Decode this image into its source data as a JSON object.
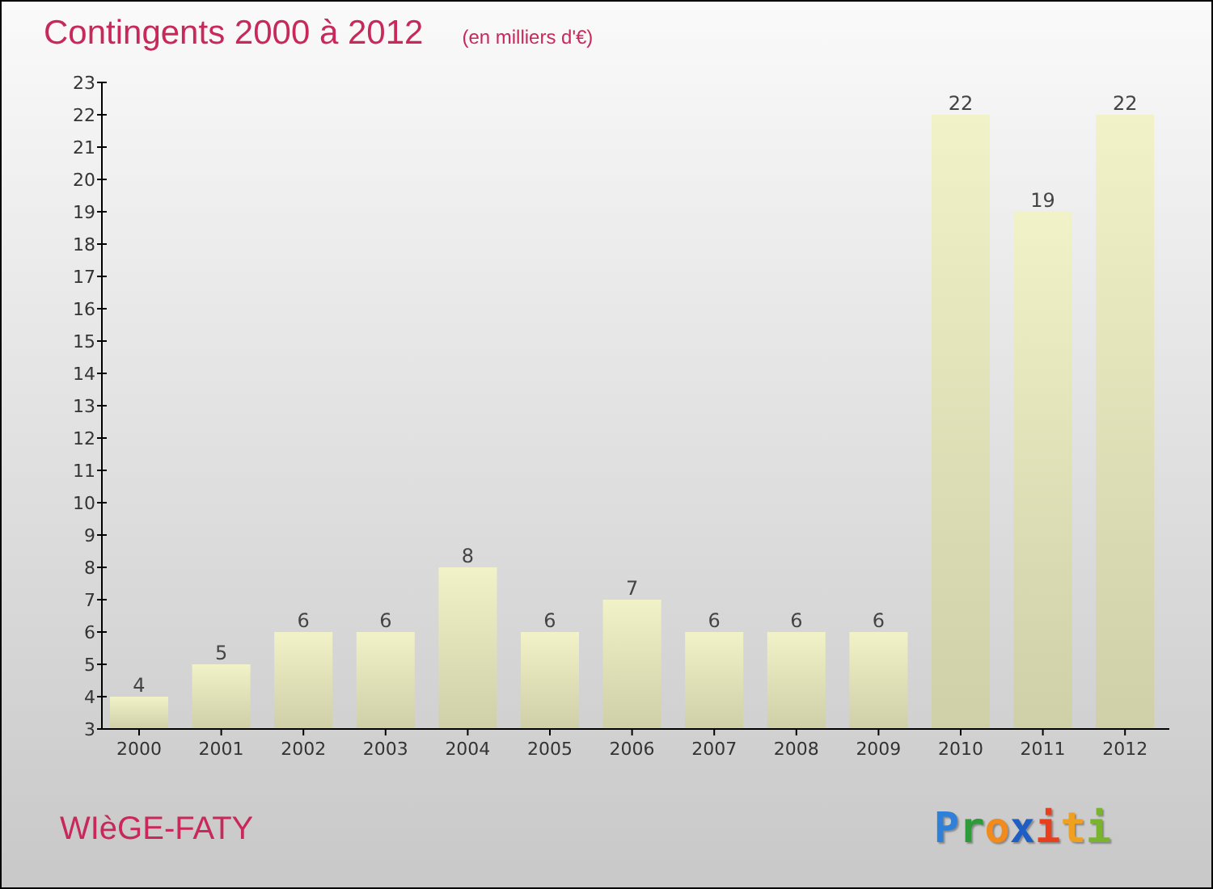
{
  "chart_title": "Contingents 2000 à 2012",
  "unit_note": "(en milliers d'€)",
  "chart_data": {
    "type": "bar",
    "categories": [
      "2000",
      "2001",
      "2002",
      "2003",
      "2004",
      "2005",
      "2006",
      "2007",
      "2008",
      "2009",
      "2010",
      "2011",
      "2012"
    ],
    "series": [
      {
        "color": "#f2f2c8",
        "values": [
          4,
          5,
          6,
          6,
          8,
          6,
          7,
          6,
          6,
          6,
          22,
          19,
          22
        ]
      }
    ],
    "ylim": [
      3,
      23
    ],
    "yticks": [
      3,
      4,
      5,
      6,
      7,
      8,
      9,
      10,
      11,
      12,
      13,
      14,
      15,
      16,
      17,
      18,
      19,
      20,
      21,
      22,
      23
    ],
    "data_labels": true,
    "value_labels": [
      "4",
      "5",
      "6",
      "6",
      "8",
      "6",
      "7",
      "6",
      "6",
      "6",
      "22",
      "19",
      "22"
    ]
  },
  "place": "WIèGE-FATY",
  "logo": [
    {
      "text": "P",
      "color": "#2f80d8"
    },
    {
      "text": "r",
      "color": "#2e9a3a"
    },
    {
      "text": "o",
      "color": "#f28a1c"
    },
    {
      "text": "x",
      "color": "#1f5fc4"
    },
    {
      "text": "i",
      "color": "#e8401c"
    },
    {
      "text": "t",
      "color": "#f0a020"
    },
    {
      "text": "i",
      "color": "#7ab32e"
    }
  ]
}
